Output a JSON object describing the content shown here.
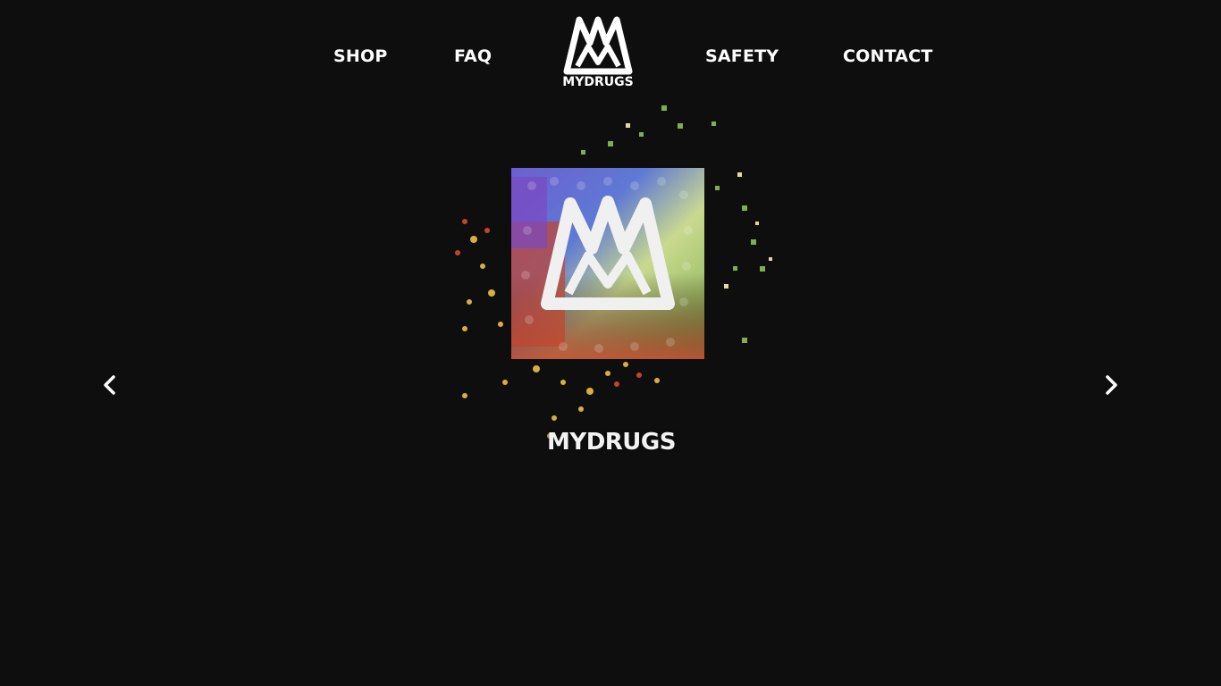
{
  "header": {
    "nav_left": [
      {
        "label": "SHOP"
      },
      {
        "label": "FAQ"
      }
    ],
    "nav_right": [
      {
        "label": "SAFETY"
      },
      {
        "label": "CONTACT"
      }
    ],
    "logo": {
      "icon": "crown-m-logo-icon",
      "text": "MYDRUGS"
    }
  },
  "hero": {
    "slide_image": "mydrugs-pills-logo-illustration",
    "wordmark": "MYDRUGS",
    "prev_icon": "chevron-left-icon",
    "next_icon": "chevron-right-icon"
  },
  "colors": {
    "background": "#0e0e0f",
    "text": "#ffffff"
  }
}
